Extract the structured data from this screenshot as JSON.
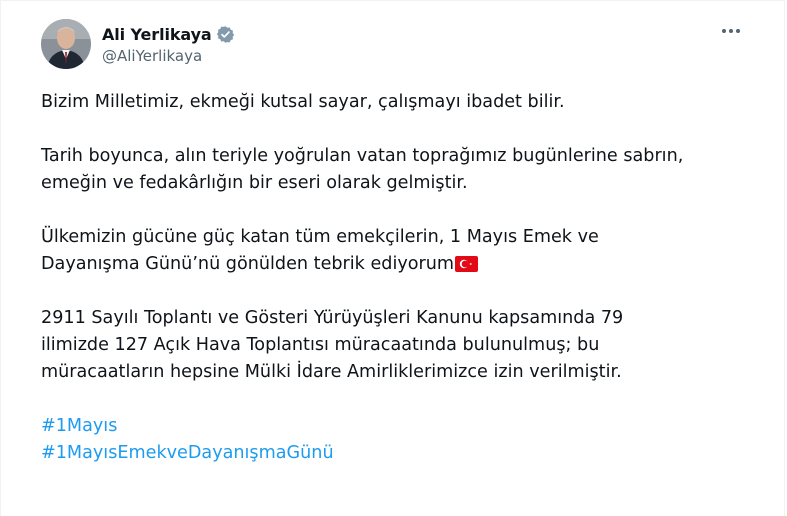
{
  "author": {
    "display_name": "Ali Yerlikaya",
    "handle": "@AliYerlikaya",
    "verified_icon": "verified-badge-icon",
    "avatar": "avatar"
  },
  "more_icon": "more-options-icon",
  "tweet": {
    "p1": "Bizim Milletimiz, ekmeği kutsal sayar, çalışmayı ibadet bilir.",
    "p2_line1": "Tarih boyunca, alın teriyle yoğrulan vatan toprağımız bugünlerine sabrın,",
    "p2_line2": "emeğin ve fedakârlığın bir eseri olarak gelmiştir.",
    "p3_line1": "Ülkemizin gücüne güç katan tüm emekçilerin, 1 Mayıs Emek ve",
    "p3_line2": "Dayanışma Günü’nü gönülden tebrik ediyorum",
    "flag_icon": "turkey-flag-icon",
    "p4_line1": "2911 Sayılı Toplantı ve Gösteri Yürüyüşleri Kanunu kapsamında 79",
    "p4_line2": "ilimizde 127 Açık Hava Toplantısı müracaatında bulunulmuş; bu",
    "p4_line3": "müracaatların hepsine Mülki İdare Amirliklerimizce izin verilmiştir.",
    "hashtags": [
      "#1Mayıs",
      "#1MayısEmekveDayanışmaGünü"
    ]
  },
  "colors": {
    "text": "#0f1419",
    "secondary": "#536471",
    "link": "#1d9bf0",
    "verified": "#829aab"
  }
}
